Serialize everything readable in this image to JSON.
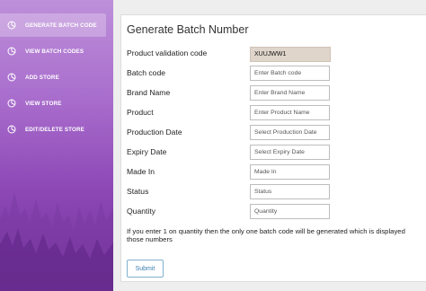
{
  "sidebar": {
    "items": [
      {
        "label": "GENERATE BATCH CODE",
        "icon": "pie-chart-icon",
        "active": true
      },
      {
        "label": "VIEW BATCH CODES",
        "icon": "pie-chart-icon"
      },
      {
        "label": "ADD STORE",
        "icon": "pie-chart-icon"
      },
      {
        "label": "VIEW STORE",
        "icon": "pie-chart-icon"
      },
      {
        "label": "EDIT/DELETE STORE",
        "icon": "pie-chart-icon"
      }
    ]
  },
  "form": {
    "title": "Generate Batch Number",
    "product_validation_code": {
      "label": "Product validation code",
      "value": "XUUJWW1"
    },
    "batch_code": {
      "label": "Batch code",
      "placeholder": "Enter Batch code"
    },
    "brand_name": {
      "label": "Brand Name",
      "placeholder": "Enter Brand Name"
    },
    "product": {
      "label": "Product",
      "placeholder": "Enter Product Name"
    },
    "production_date": {
      "label": "Production Date",
      "placeholder": "Select Production Date"
    },
    "expiry_date": {
      "label": "Expiry Date",
      "placeholder": "Select Expiry Date"
    },
    "made_in": {
      "label": "Made In",
      "placeholder": "Made In"
    },
    "status": {
      "label": "Status",
      "placeholder": "Status"
    },
    "quantity": {
      "label": "Quantity",
      "placeholder": "Quantity"
    },
    "note_line1": "If you enter 1 on quantity then the only one batch code will be generated which is displayed",
    "note_line2": "those numbers",
    "submit_label": "Submit"
  },
  "colors": {
    "sidebar_top": "#bd8fda",
    "sidebar_bottom": "#6f3196",
    "submit_accent": "#3a7fb0",
    "code_box_bg": "#dfd5cb"
  }
}
